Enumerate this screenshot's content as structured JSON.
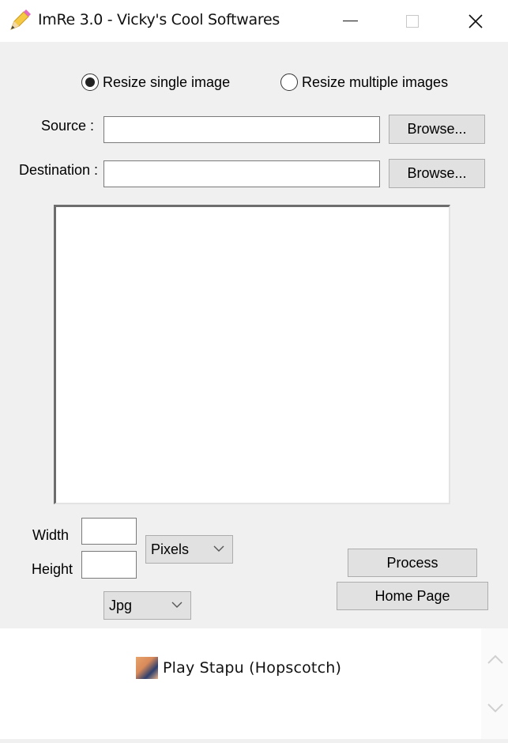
{
  "window": {
    "title": "ImRe 3.0 - Vicky's Cool Softwares",
    "app_icon": "pencil-icon",
    "controls": {
      "minimize": "minimize-icon",
      "maximize": "maximize-icon",
      "close": "close-icon"
    }
  },
  "mode": {
    "options": [
      {
        "label": "Resize single image",
        "selected": true
      },
      {
        "label": "Resize multiple images",
        "selected": false
      }
    ]
  },
  "source": {
    "label": "Source :",
    "value": "",
    "browse_label": "Browse..."
  },
  "destination": {
    "label": "Destination :",
    "value": "",
    "browse_label": "Browse..."
  },
  "size": {
    "width_label": "Width",
    "width_value": "",
    "height_label": "Height",
    "height_value": "",
    "unit_selected": "Pixels",
    "format_selected": "Jpg"
  },
  "actions": {
    "process_label": "Process",
    "home_page_label": "Home Page"
  },
  "ad": {
    "text": "Play Stapu (Hopscotch)",
    "icon": "game-thumbnail-icon"
  }
}
